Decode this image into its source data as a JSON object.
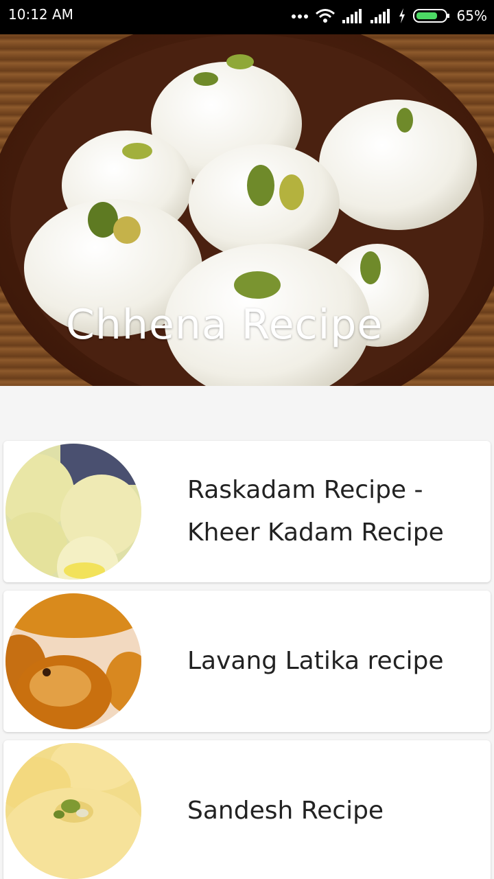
{
  "status_bar": {
    "time": "10:12 AM",
    "battery": "65%",
    "icons": [
      "more-dots-icon",
      "wifi-icon",
      "signal-icon",
      "signal-icon",
      "charging-icon",
      "battery-icon"
    ]
  },
  "header": {
    "title": "Chhena Recipe"
  },
  "recipes": [
    {
      "title": "Raskadam Recipe - Kheer Kadam Recipe"
    },
    {
      "title": "Lavang Latika recipe"
    },
    {
      "title": "Sandesh Recipe"
    }
  ],
  "colors": {
    "status_bar": "#000000",
    "background": "#f5f5f5",
    "card": "#ffffff",
    "title_text": "#222222",
    "battery_fill": "#4cd964"
  }
}
